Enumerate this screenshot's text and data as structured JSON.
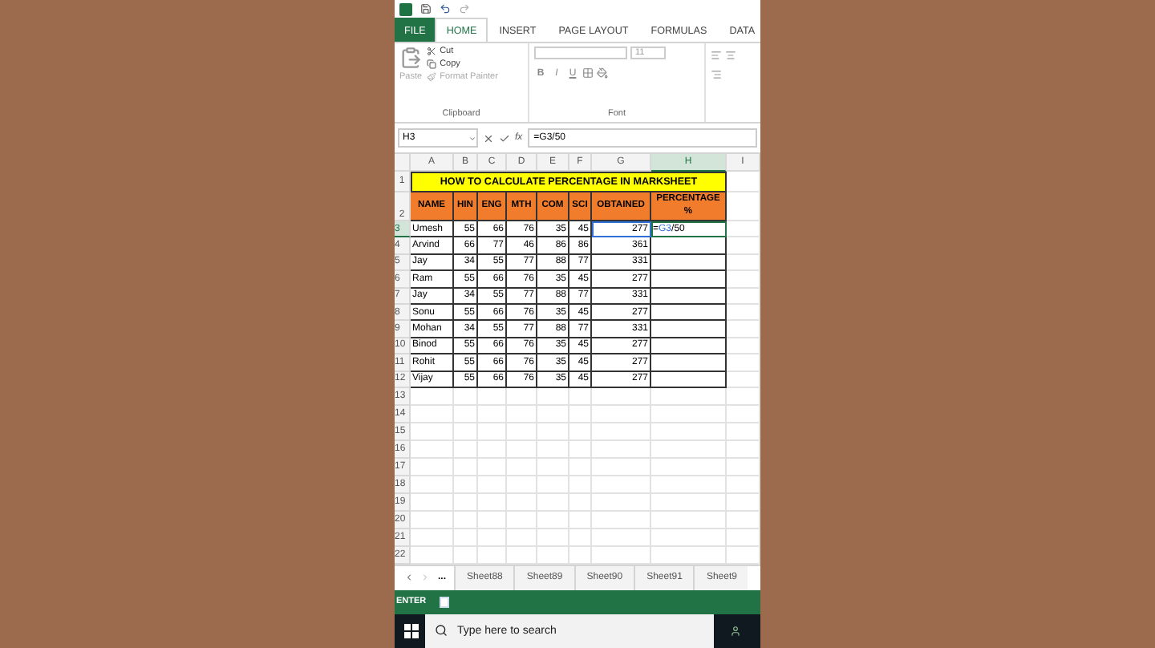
{
  "ribbon_tabs": [
    {
      "label": "FILE",
      "kind": "file",
      "selected": false
    },
    {
      "label": "HOME",
      "kind": "tab",
      "selected": true
    },
    {
      "label": "INSERT",
      "kind": "tab",
      "selected": false
    },
    {
      "label": "PAGE LAYOUT",
      "kind": "tab",
      "selected": false
    },
    {
      "label": "FORMULAS",
      "kind": "tab",
      "selected": false
    },
    {
      "label": "DATA",
      "kind": "tab",
      "selected": false
    }
  ],
  "clipboard": {
    "paste": "Paste",
    "cut": "Cut",
    "copy": "Copy",
    "format_painter": "Format Painter",
    "label": "Clipboard"
  },
  "font": {
    "size": "11",
    "styles": [
      "B",
      "I",
      "U"
    ],
    "label": "Font"
  },
  "formula_bar": {
    "name_box": "H3",
    "fx": "fx",
    "formula": "=G3/50"
  },
  "columns": [
    {
      "label": "A",
      "selected": false
    },
    {
      "label": "B",
      "selected": false
    },
    {
      "label": "C",
      "selected": false
    },
    {
      "label": "D",
      "selected": false
    },
    {
      "label": "E",
      "selected": false
    },
    {
      "label": "F",
      "selected": false
    },
    {
      "label": "G",
      "selected": false
    },
    {
      "label": "H",
      "selected": true
    },
    {
      "label": "I",
      "selected": false
    }
  ],
  "title_row": {
    "number": "1",
    "text": "HOW TO CALCULATE PERCENTAGE IN MARKSHEET"
  },
  "header_row": {
    "number": "2",
    "cells": [
      "NAME",
      "HIN",
      "ENG",
      "MTH",
      "COM",
      "SCI",
      "OBTAINED",
      "PERCENTAGE %"
    ]
  },
  "rows": [
    {
      "number": "3",
      "selected": true,
      "cells": [
        "Umesh",
        "55",
        "66",
        "76",
        "35",
        "45",
        "277"
      ],
      "editing": {
        "prefix": "=",
        "reference": "G3",
        "suffix": "/50"
      }
    },
    {
      "number": "4",
      "selected": false,
      "cells": [
        "Arvind",
        "66",
        "77",
        "46",
        "86",
        "86",
        "361"
      ]
    },
    {
      "number": "5",
      "selected": false,
      "cells": [
        "Jay",
        "34",
        "55",
        "77",
        "88",
        "77",
        "331"
      ]
    },
    {
      "number": "6",
      "selected": false,
      "cells": [
        "Ram",
        "55",
        "66",
        "76",
        "35",
        "45",
        "277"
      ]
    },
    {
      "number": "7",
      "selected": false,
      "cells": [
        "Jay",
        "34",
        "55",
        "77",
        "88",
        "77",
        "331"
      ]
    },
    {
      "number": "8",
      "selected": false,
      "cells": [
        "Sonu",
        "55",
        "66",
        "76",
        "35",
        "45",
        "277"
      ]
    },
    {
      "number": "9",
      "selected": false,
      "cells": [
        "Mohan",
        "34",
        "55",
        "77",
        "88",
        "77",
        "331"
      ]
    },
    {
      "number": "10",
      "selected": false,
      "cells": [
        "Binod",
        "55",
        "66",
        "76",
        "35",
        "45",
        "277"
      ]
    },
    {
      "number": "11",
      "selected": false,
      "cells": [
        "Rohit",
        "55",
        "66",
        "76",
        "35",
        "45",
        "277"
      ]
    },
    {
      "number": "12",
      "selected": false,
      "cells": [
        "Vijay",
        "55",
        "66",
        "76",
        "35",
        "45",
        "277"
      ]
    }
  ],
  "empty_rows": [
    "13",
    "14",
    "15",
    "16",
    "17",
    "18",
    "19",
    "20",
    "21",
    "22"
  ],
  "sheet_tabs": {
    "more": "...",
    "tabs": [
      {
        "label": "Sheet88",
        "selected": false
      },
      {
        "label": "Sheet89",
        "selected": false
      },
      {
        "label": "Sheet90",
        "selected": false
      },
      {
        "label": "Sheet91",
        "selected": false
      },
      {
        "label": "Sheet9",
        "selected": false
      }
    ]
  },
  "status_bar": {
    "mode": "ENTER"
  },
  "taskbar": {
    "search_placeholder": "Type here to search"
  }
}
